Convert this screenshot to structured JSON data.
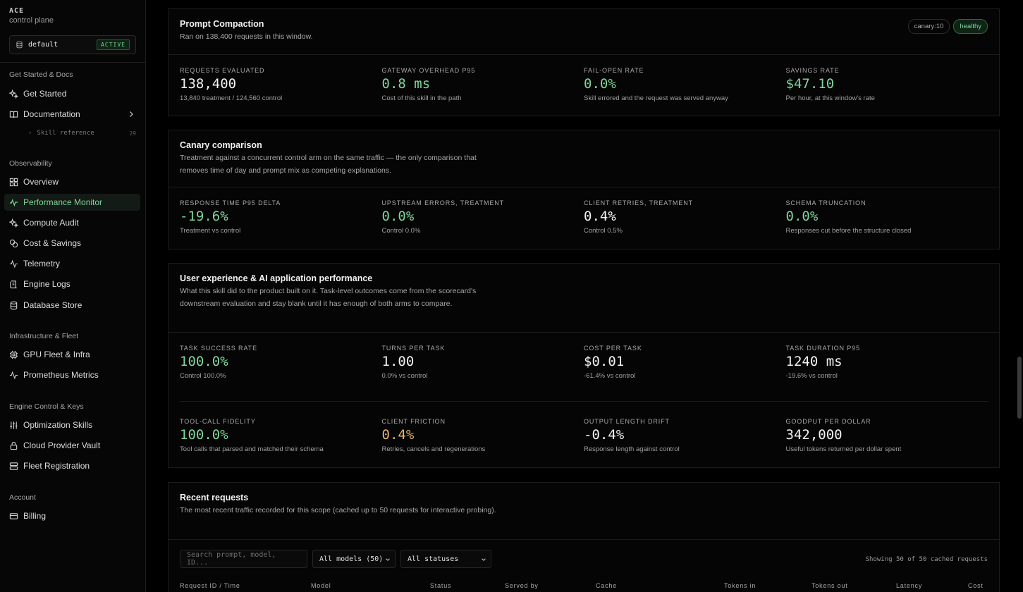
{
  "brand": {
    "name": "ACE",
    "subtitle": "control plane"
  },
  "scope": {
    "name": "default",
    "badge": "ACTIVE"
  },
  "sidebar": {
    "sections": {
      "docs": "Get Started & Docs",
      "observability": "Observability",
      "infra": "Infrastructure & Fleet",
      "engine": "Engine Control & Keys",
      "account": "Account"
    },
    "items": {
      "get_started": "Get Started",
      "documentation": "Documentation",
      "skill_reference": "Skill reference",
      "skill_reference_count": "29",
      "overview": "Overview",
      "performance_monitor": "Performance Monitor",
      "compute_audit": "Compute Audit",
      "cost_savings": "Cost & Savings",
      "telemetry": "Telemetry",
      "engine_logs": "Engine Logs",
      "database_store": "Database Store",
      "gpu_fleet": "GPU Fleet & Infra",
      "prometheus": "Prometheus Metrics",
      "optimization_skills": "Optimization Skills",
      "cloud_vault": "Cloud Provider Vault",
      "fleet_registration": "Fleet Registration",
      "billing": "Billing"
    },
    "active_item": "performance_monitor"
  },
  "prompt_compaction": {
    "title": "Prompt Compaction",
    "desc": "Ran on 138,400 requests in this window.",
    "tags": [
      "canary:10",
      "healthy"
    ],
    "metrics": [
      {
        "label": "Requests evaluated",
        "value": "138,400",
        "sub": "13,840 treatment / 124,560 control"
      },
      {
        "label": "Gateway overhead P95",
        "value": "0.8 ms",
        "sub": "Cost of this skill in the path"
      },
      {
        "label": "Fail-open rate",
        "value": "0.0%",
        "sub": "Skill errored and the request was served anyway"
      },
      {
        "label": "Savings rate",
        "value": "$47.10",
        "sub": "Per hour, at this window's rate"
      }
    ]
  },
  "canary": {
    "title": "Canary comparison",
    "desc": "Treatment against a concurrent control arm on the same traffic — the only comparison that removes time of day and prompt mix as competing explanations.",
    "metrics": [
      {
        "label": "Response time P95 delta",
        "value": "-19.6%",
        "sub": "Treatment vs control"
      },
      {
        "label": "Upstream errors, treatment",
        "value": "0.0%",
        "sub": "Control 0.0%"
      },
      {
        "label": "Client retries, treatment",
        "value": "0.4%",
        "sub": "Control 0.5%"
      },
      {
        "label": "Schema truncation",
        "value": "0.0%",
        "sub": "Responses cut before the structure closed"
      }
    ]
  },
  "ux": {
    "title": "User experience & AI application performance",
    "desc": "What this skill did to the product built on it. Task-level outcomes come from the scorecard's downstream evaluation and stay blank until it has enough of both arms to compare.",
    "metrics_row1": [
      {
        "label": "Task success rate",
        "value": "100.0%",
        "sub": "Control 100.0%"
      },
      {
        "label": "Turns per task",
        "value": "1.00",
        "sub": "0.0% vs control"
      },
      {
        "label": "Cost per task",
        "value": "$0.01",
        "sub": "-61.4% vs control"
      },
      {
        "label": "Task duration P95",
        "value": "1240 ms",
        "sub": "-19.6% vs control"
      }
    ],
    "metrics_row2": [
      {
        "label": "Tool-call fidelity",
        "value": "100.0%",
        "sub": "Tool calls that parsed and matched their schema"
      },
      {
        "label": "Client friction",
        "value": "0.4%",
        "sub": "Retries, cancels and regenerations"
      },
      {
        "label": "Output length drift",
        "value": "-0.4%",
        "sub": "Response length against control"
      },
      {
        "label": "Goodput per dollar",
        "value": "342,000",
        "sub": "Useful tokens returned per dollar spent"
      }
    ]
  },
  "recent": {
    "title": "Recent requests",
    "desc": "The most recent traffic recorded for this scope (cached up to 50 requests for interactive probing).",
    "search_placeholder": "Search prompt, model, ID...",
    "model_filter": "All models (50)",
    "status_filter": "All statuses",
    "showing": "Showing 50 of 50 cached requests",
    "columns": [
      "Request ID / Time",
      "Model",
      "Status",
      "Served by",
      "Cache",
      "Tokens in",
      "Tokens out",
      "Latency",
      "Cost"
    ]
  },
  "colors": {
    "accent": "#7ed69a",
    "amber": "#e5b36b",
    "background": "#000000"
  }
}
